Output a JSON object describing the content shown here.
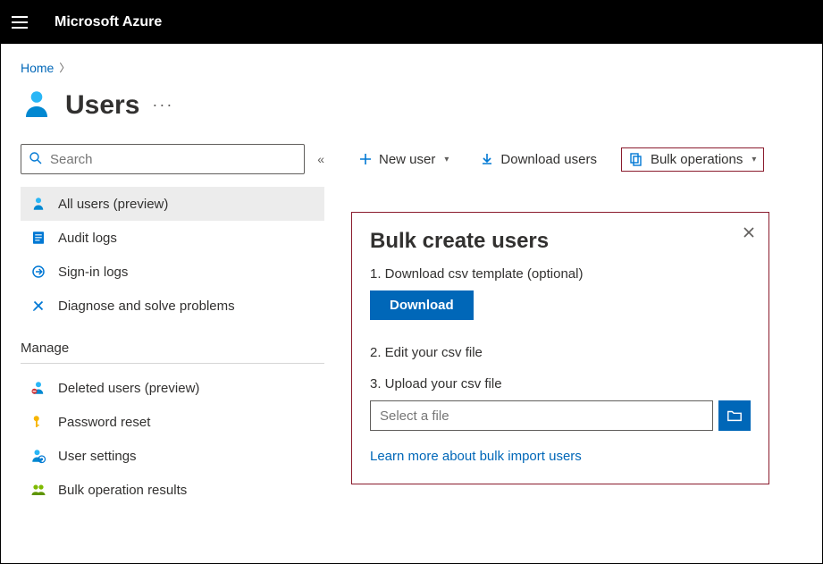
{
  "brand": "Microsoft Azure",
  "breadcrumb": {
    "home": "Home"
  },
  "page": {
    "title": "Users",
    "search_placeholder": "Search"
  },
  "sidebar": {
    "items": [
      {
        "label": "All users (preview)"
      },
      {
        "label": "Audit logs"
      },
      {
        "label": "Sign-in logs"
      },
      {
        "label": "Diagnose and solve problems"
      }
    ],
    "manage_label": "Manage",
    "manage_items": [
      {
        "label": "Deleted users (preview)"
      },
      {
        "label": "Password reset"
      },
      {
        "label": "User settings"
      },
      {
        "label": "Bulk operation results"
      }
    ]
  },
  "toolbar": {
    "new_user": "New user",
    "download_users": "Download users",
    "bulk_ops": "Bulk operations"
  },
  "panel": {
    "title": "Bulk create users",
    "step1": "1. Download csv template (optional)",
    "download_label": "Download",
    "step2": "2. Edit your csv file",
    "step3": "3. Upload your csv file",
    "file_placeholder": "Select a file",
    "learn_more": "Learn more about bulk import users"
  }
}
